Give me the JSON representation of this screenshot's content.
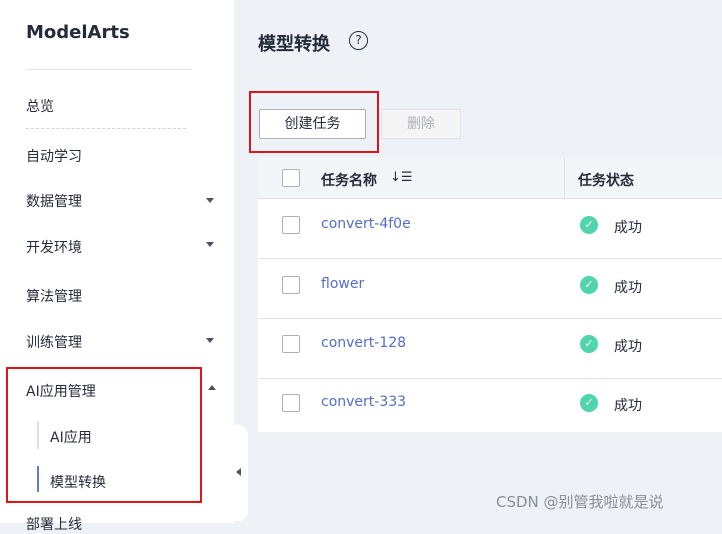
{
  "sidebar": {
    "brand": "ModelArts",
    "items": [
      {
        "label": "总览"
      },
      {
        "label": "自动学习"
      },
      {
        "label": "数据管理"
      },
      {
        "label": "开发环境"
      },
      {
        "label": "算法管理"
      },
      {
        "label": "训练管理"
      },
      {
        "label": "AI应用管理"
      },
      {
        "label": "部署上线"
      }
    ],
    "subitems": [
      {
        "label": "AI应用"
      },
      {
        "label": "模型转换"
      }
    ],
    "active_subitem": "模型转换"
  },
  "page": {
    "title": "模型转换",
    "help_glyph": "?"
  },
  "toolbar": {
    "create_label": "创建任务",
    "delete_label": "删除"
  },
  "table": {
    "columns": [
      "任务名称",
      "任务状态"
    ],
    "rows": [
      {
        "name": "convert-4f0e",
        "status": "成功"
      },
      {
        "name": "flower",
        "status": "成功"
      },
      {
        "name": "convert-128",
        "status": "成功"
      },
      {
        "name": "convert-333",
        "status": "成功"
      }
    ]
  },
  "watermark": "CSDN @别管我啦就是说",
  "icons": [
    "help-icon",
    "sort-icon",
    "chevron-down-icon",
    "chevron-up-icon",
    "collapse-left-icon",
    "check-circle-icon"
  ],
  "colors": {
    "accent": "#5e7ce0",
    "link": "#526ecc",
    "success": "#50d4ab",
    "highlight": "#e0141c"
  }
}
